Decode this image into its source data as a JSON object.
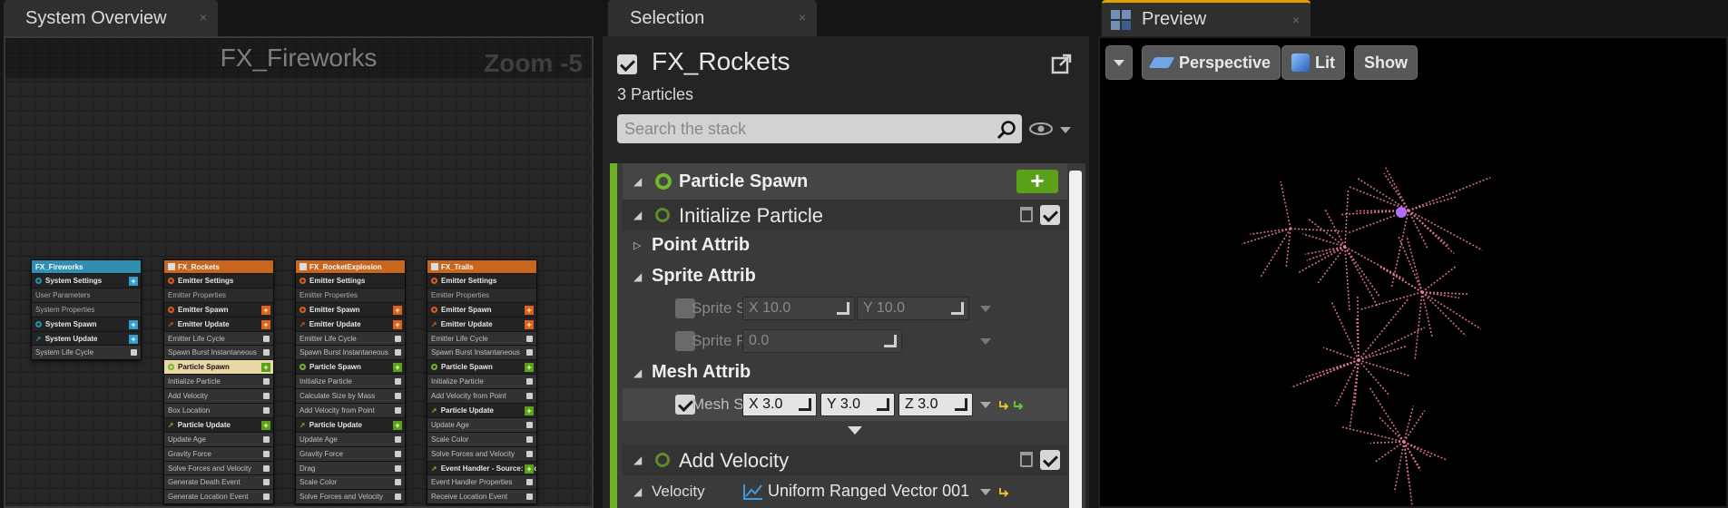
{
  "tabs": {
    "system_overview": "System Overview",
    "selection": "Selection",
    "preview": "Preview",
    "close_glyph": "×"
  },
  "graph": {
    "title": "FX_Fireworks",
    "zoom": "Zoom -5",
    "system_node": {
      "title": "FX_Fireworks",
      "color": "#2f8fb2",
      "rows": [
        "System Settings",
        "User Parameters",
        "System Properties",
        "System Spawn",
        "System Update",
        "System Life Cycle"
      ]
    },
    "emitters": [
      {
        "title": "FX_Rockets",
        "color": "#c8661e",
        "rows": [
          "Emitter Settings",
          "Emitter Properties",
          "Emitter Spawn",
          "Emitter Update",
          "Emitter Life Cycle",
          "Spawn Burst Instantaneous",
          "Particle Spawn",
          "Initialize Particle",
          "Add Velocity",
          "Box Location",
          "Particle Update",
          "Update Age",
          "Gravity Force",
          "Solve Forces and Velocity",
          "Generate Death Event",
          "Generate Location Event"
        ]
      },
      {
        "title": "FX_RocketExplosion",
        "color": "#c8661e",
        "rows": [
          "Emitter Settings",
          "Emitter Properties",
          "Emitter Spawn",
          "Emitter Update",
          "Emitter Life Cycle",
          "Spawn Burst Instantaneous",
          "Particle Spawn",
          "Initialize Particle",
          "Calculate Size by Mass",
          "Add Velocity from Point",
          "Particle Update",
          "Update Age",
          "Gravity Force",
          "Drag",
          "Scale Color",
          "Solve Forces and Velocity"
        ]
      },
      {
        "title": "FX_Trails",
        "color": "#c8661e",
        "rows": [
          "Emitter Settings",
          "Emitter Properties",
          "Emitter Spawn",
          "Emitter Update",
          "Emitter Life Cycle",
          "Spawn Burst Instantaneous",
          "Particle Spawn",
          "Initialize Particle",
          "Add Velocity from Point",
          "Particle Update",
          "Update Age",
          "Scale Color",
          "Solve Forces and Velocity",
          "Event Handler - Source: Locati",
          "Event Handler Properties",
          "Receive Location Event"
        ]
      }
    ]
  },
  "selection": {
    "emitter_name": "FX_Rockets",
    "particle_count": "3 Particles",
    "search_placeholder": "Search the stack",
    "stack": {
      "particle_spawn": "Particle Spawn",
      "plus": "+",
      "initialize_particle": "Initialize Particle",
      "point_attributes": "Point Attrib",
      "sprite_attributes": "Sprite Attrib",
      "sprite_size_label": "Sprite S",
      "sprite_size_x": "X  10.0",
      "sprite_size_y": "Y  10.0",
      "sprite_rotation_label": "Sprite R",
      "sprite_rotation_value": "0.0",
      "mesh_attributes": "Mesh Attrib",
      "mesh_scale_label": "Mesh S",
      "mesh_scale_x": "X  3.0",
      "mesh_scale_y": "Y  3.0",
      "mesh_scale_z": "Z  3.0",
      "add_velocity": "Add Velocity",
      "velocity_label": "Velocity",
      "velocity_value": "Uniform Ranged Vector 001"
    }
  },
  "preview": {
    "perspective": "Perspective",
    "lit": "Lit",
    "show": "Show"
  },
  "colors": {
    "accent_green": "#70b028",
    "emitter_orange": "#c8661e",
    "system_blue": "#2f8fb2",
    "firework_pink": "#e87aa0"
  }
}
